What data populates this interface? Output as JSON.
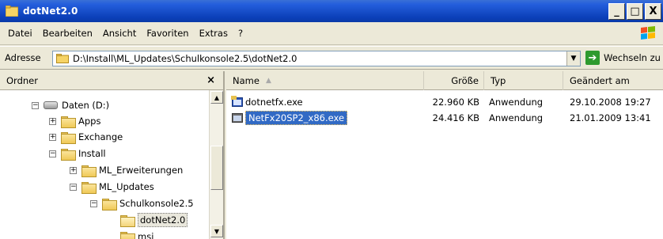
{
  "window": {
    "title": "dotNet2.0",
    "minimize_glyph": "_",
    "maximize_glyph": "□",
    "close_glyph": "X"
  },
  "menu": {
    "items": [
      {
        "label": "Datei"
      },
      {
        "label": "Bearbeiten"
      },
      {
        "label": "Ansicht"
      },
      {
        "label": "Favoriten"
      },
      {
        "label": "Extras"
      },
      {
        "label": "?"
      }
    ]
  },
  "address": {
    "label": "Adresse",
    "value": "D:\\Install\\ML_Updates\\Schulkonsole2.5\\dotNet2.0",
    "go_label": "Wechseln zu"
  },
  "folder_pane": {
    "title": "Ordner",
    "close_glyph": "×",
    "tree": [
      {
        "label": "Daten (D:)",
        "expander": "−",
        "icon": "drive-icon"
      },
      {
        "label": "Apps",
        "expander": "+",
        "icon": "folder-icon"
      },
      {
        "label": "Exchange",
        "expander": "+",
        "icon": "folder-icon"
      },
      {
        "label": "Install",
        "expander": "−",
        "icon": "folder-icon"
      },
      {
        "label": "ML_Erweiterungen",
        "expander": "+",
        "icon": "folder-icon"
      },
      {
        "label": "ML_Updates",
        "expander": "−",
        "icon": "folder-icon"
      },
      {
        "label": "Schulkonsole2.5",
        "expander": "−",
        "icon": "folder-icon"
      },
      {
        "label": "dotNet2.0",
        "expander": "",
        "icon": "folder-open-icon",
        "selected": true
      },
      {
        "label": "msi",
        "expander": "",
        "icon": "folder-icon"
      }
    ]
  },
  "file_list": {
    "columns": [
      {
        "label": "Name"
      },
      {
        "label": "Größe"
      },
      {
        "label": "Typ"
      },
      {
        "label": "Geändert am"
      }
    ],
    "rows": [
      {
        "name": "dotnetfx.exe",
        "size": "22.960 KB",
        "type": "Anwendung",
        "modified": "29.10.2008 19:27",
        "selected": false
      },
      {
        "name": "NetFx20SP2_x86.exe",
        "size": "24.416 KB",
        "type": "Anwendung",
        "modified": "21.01.2009 13:41",
        "selected": true
      }
    ]
  },
  "colors": {
    "titlebar": "#0b3fb8",
    "selection": "#316ac5",
    "chrome": "#ece9d8"
  }
}
